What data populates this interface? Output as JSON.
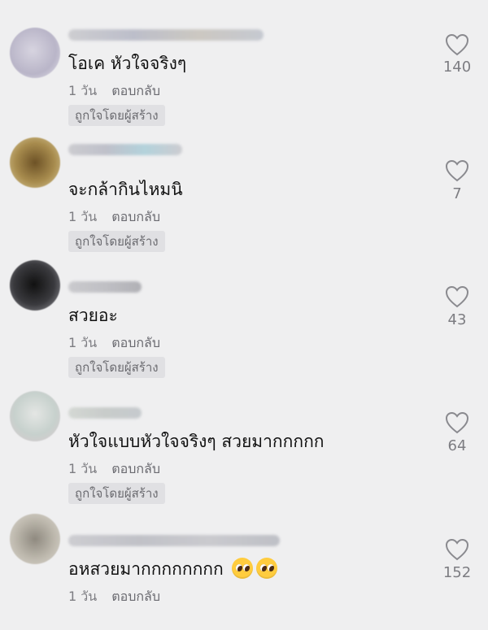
{
  "comments": [
    {
      "text": "โอเค หัวใจจริงๆ",
      "time": "1 วัน",
      "reply": "ตอบกลับ",
      "badge": "ถูกใจโดยผู้สร้าง",
      "likes": "140",
      "avatar_color": "#c9c6d6"
    },
    {
      "text": "จะกล้ากินไหมนิ",
      "time": "1 วัน",
      "reply": "ตอบกลับ",
      "badge": "ถูกใจโดยผู้สร้าง",
      "likes": "7",
      "avatar_color": "#9b7a3a"
    },
    {
      "text": "สวยอะ",
      "time": "1 วัน",
      "reply": "ตอบกลับ",
      "badge": "ถูกใจโดยผู้สร้าง",
      "likes": "43",
      "avatar_color": "#2a2a2c"
    },
    {
      "text": "หัวใจแบบหัวใจจริงๆ สวยมากกกกก",
      "time": "1 วัน",
      "reply": "ตอบกลับ",
      "badge": "ถูกใจโดยผู้สร้าง",
      "likes": "64",
      "avatar_color": "#cfd3d1"
    },
    {
      "text": "อหสวยมากกกกกกกก",
      "time": "1 วัน",
      "reply": "ตอบกลับ",
      "likes": "152",
      "avatar_color": "#b8b3a8",
      "emoji": "pleading-face-icon"
    }
  ]
}
